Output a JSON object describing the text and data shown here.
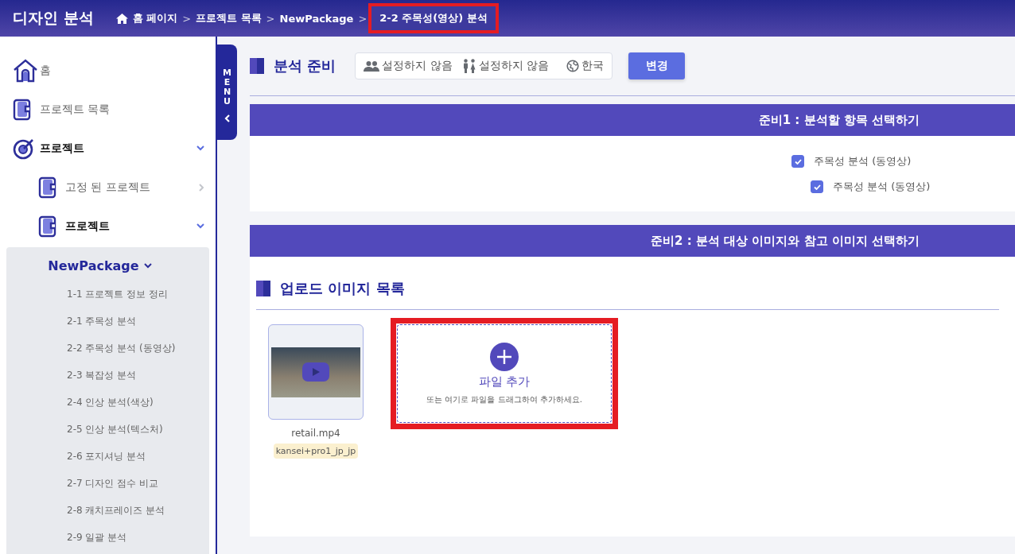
{
  "header": {
    "title": "디자인 분석",
    "separator": ">",
    "breadcrumb": [
      {
        "label": "홈 페이지",
        "kind": "home",
        "highlighted": false
      },
      {
        "label": "프로젝트 목록",
        "kind": "text",
        "highlighted": false
      },
      {
        "label": "NewPackage",
        "kind": "text",
        "highlighted": false
      },
      {
        "label": "2-2 주목성(영상) 분석",
        "kind": "text",
        "highlighted": true
      }
    ]
  },
  "sidebar": {
    "items": [
      {
        "label": "홈",
        "kind": "home",
        "bold": false
      },
      {
        "label": "프로젝트 목록",
        "kind": "book",
        "bold": false
      },
      {
        "label": "프로젝트",
        "kind": "target",
        "bold": true,
        "expanded": true,
        "children": [
          {
            "label": "고정 된 프로젝트",
            "kind": "book",
            "bold": false,
            "expanded": false
          },
          {
            "label": "프로젝트",
            "kind": "book",
            "bold": true,
            "expanded": true,
            "children": [
              {
                "label": "NewPackage",
                "kind": "group",
                "expanded": true,
                "children": [
                  {
                    "label": "1-1 프로젝트 정보 정리"
                  },
                  {
                    "label": "2-1 주목성 분석"
                  },
                  {
                    "label": "2-2 주목성 분석 (동영상)"
                  },
                  {
                    "label": "2-3 복잡성 분석"
                  },
                  {
                    "label": "2-4 인상 분석(색상)"
                  },
                  {
                    "label": "2-5 인상 분석(텍스처)"
                  },
                  {
                    "label": "2-6 포지셔닝 분석"
                  },
                  {
                    "label": "2-7 디자인 점수 비교"
                  },
                  {
                    "label": "2-8 캐치프레이즈 분석"
                  },
                  {
                    "label": "2-9 일괄 분석"
                  }
                ]
              }
            ]
          }
        ]
      }
    ]
  },
  "menu_tab": {
    "label": "MENU"
  },
  "prep": {
    "title": "분석 준비",
    "filters": [
      {
        "kind": "people",
        "text": "설정하지 않음"
      },
      {
        "kind": "couple",
        "text": "설정하지 않음"
      },
      {
        "kind": "globe",
        "text": "한국"
      }
    ],
    "button": "변경"
  },
  "step1": {
    "title": "준비1 : 분석할 항목 선택하기",
    "checkboxes": [
      {
        "label": "주목성 분석 (동영상)",
        "checked": true,
        "children": [
          {
            "label": "주목성 분석 (동영상)",
            "checked": true
          }
        ]
      }
    ]
  },
  "step2": {
    "title": "준비2 : 분석 대상 이미지와 참고 이미지 선택하기",
    "section_title": "업로드 이미지 목록",
    "files": [
      {
        "name": "retail.mp4",
        "tag": "kansei+pro1_jp_jp"
      }
    ],
    "upload": {
      "label": "파일 추가",
      "hint": "또는 여기로 파일을 드래그하여 추가하세요.",
      "highlighted": true
    }
  }
}
